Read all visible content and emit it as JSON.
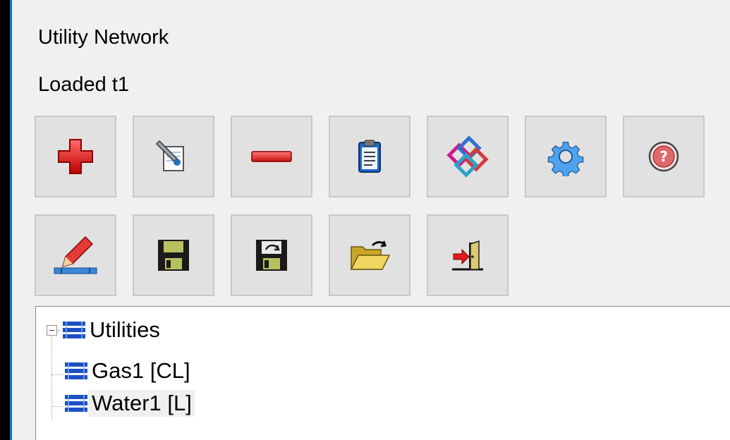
{
  "panel": {
    "title": "Utility Network",
    "status": "Loaded t1"
  },
  "toolbar": {
    "row1": [
      {
        "name": "add",
        "icon": "plus-icon"
      },
      {
        "name": "edit-properties",
        "icon": "document-edit-icon"
      },
      {
        "name": "remove",
        "icon": "minus-icon"
      },
      {
        "name": "clipboard",
        "icon": "clipboard-icon"
      },
      {
        "name": "network",
        "icon": "network-links-icon"
      },
      {
        "name": "settings",
        "icon": "gear-icon"
      },
      {
        "name": "help",
        "icon": "help-icon"
      }
    ],
    "row2": [
      {
        "name": "draw-pipe",
        "icon": "pencil-pipe-icon"
      },
      {
        "name": "save",
        "icon": "floppy-disk-icon"
      },
      {
        "name": "save-as",
        "icon": "floppy-save-as-icon"
      },
      {
        "name": "open",
        "icon": "open-folder-icon"
      },
      {
        "name": "exit",
        "icon": "exit-door-icon"
      }
    ]
  },
  "tree": {
    "root": {
      "label": "Utilities",
      "expanded": true,
      "icon": "utility-layers-icon"
    },
    "children": [
      {
        "label": "Gas1 [CL]",
        "icon": "utility-layers-icon",
        "selected": false
      },
      {
        "label": "Water1 [L]",
        "icon": "utility-layers-icon",
        "selected": true
      }
    ]
  },
  "colors": {
    "accent": "#0078d7",
    "window_bg": "#f0f0f0",
    "tree_icon": "#1e4fc4"
  }
}
